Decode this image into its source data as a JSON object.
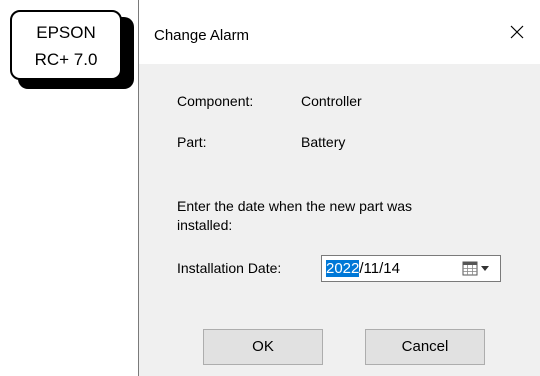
{
  "badge": {
    "line1": "EPSON",
    "line2": "RC+ 7.0"
  },
  "dialog": {
    "title": "Change Alarm",
    "component_label": "Component:",
    "component_value": "Controller",
    "part_label": "Part:",
    "part_value": "Battery",
    "instruction_line1": "Enter the date when the new part was",
    "instruction_line2": "installed:",
    "date_label": "Installation Date:",
    "date_year": "2022",
    "date_rest": "/11/14",
    "ok_label": "OK",
    "cancel_label": "Cancel"
  },
  "icons": {
    "close": "close-icon",
    "calendar": "calendar-icon",
    "dropdown": "chevron-down-icon"
  },
  "colors": {
    "selection": "#0078d7",
    "dialog_bg": "#f0f0f0",
    "button_bg": "#e1e1e1"
  }
}
